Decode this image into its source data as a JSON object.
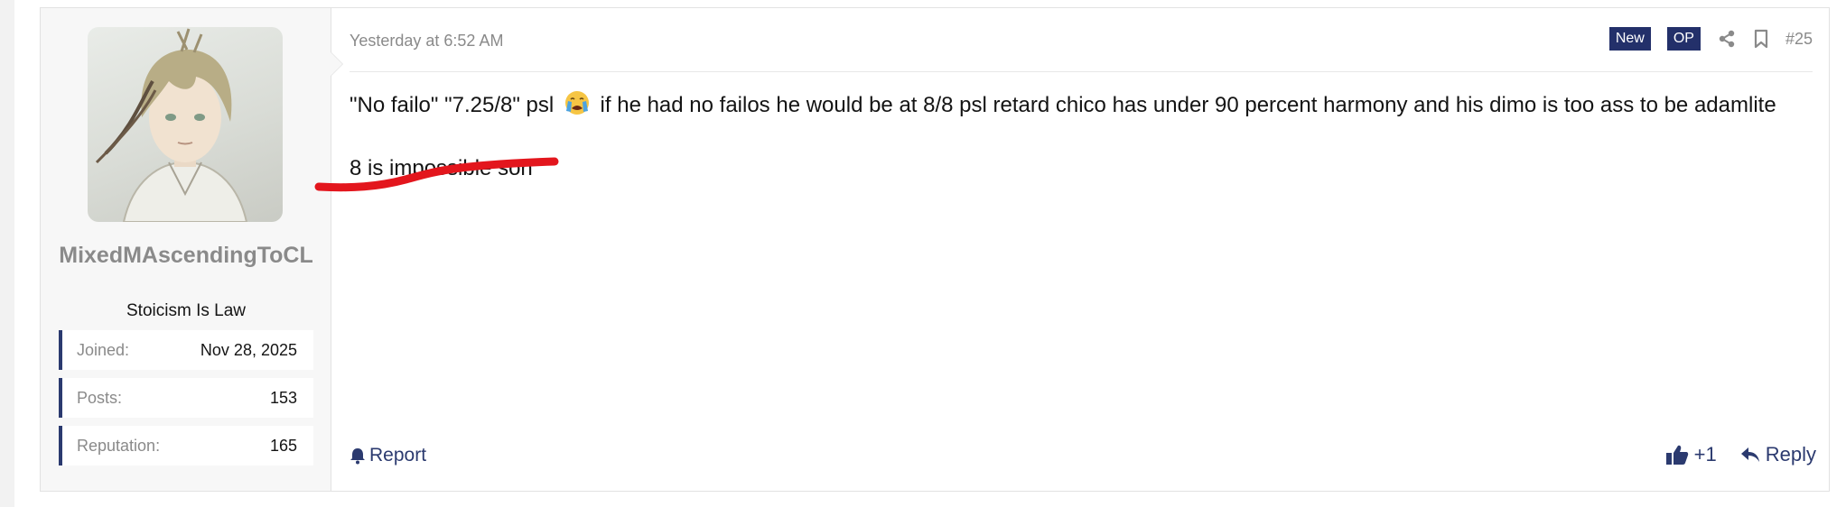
{
  "post": {
    "timestamp": "Yesterday at 6:52 AM",
    "badges": {
      "new": "New",
      "op": "OP"
    },
    "post_number": "#25",
    "body_line1": "\"No failo\" \"7.25/8\" psl",
    "emoji": "loudly-crying-face",
    "body_line1_rest": "if he had no failos he would be at 8/8 psl retard chico has under 90 percent harmony and his dimo is too ass to be adamlite",
    "body_line2": "8 is impossible son",
    "annotation_color": "#e3161d"
  },
  "user": {
    "username": "MixedMAscendingToCL",
    "title": "Stoicism Is Law",
    "stats": [
      {
        "label": "Joined:",
        "value": "Nov 28, 2025"
      },
      {
        "label": "Posts:",
        "value": "153"
      },
      {
        "label": "Reputation:",
        "value": "165"
      }
    ]
  },
  "actions": {
    "report": "Report",
    "like_count": "+1",
    "reply": "Reply"
  },
  "colors": {
    "accent": "#2b3a6f",
    "badge_bg": "#23306a",
    "muted": "#8a8a8a"
  }
}
